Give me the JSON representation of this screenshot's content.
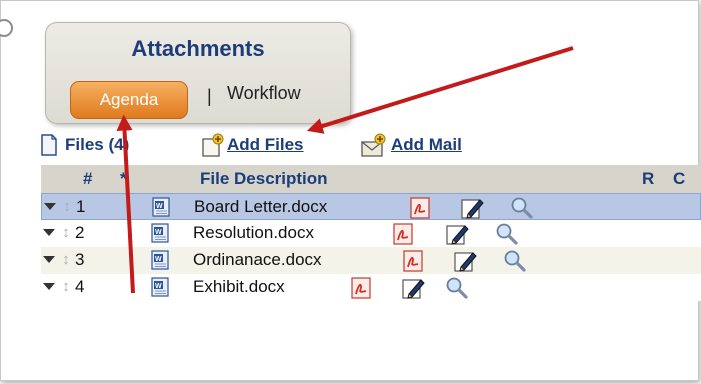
{
  "tabs": {
    "title": "Attachments",
    "agenda_label": "Agenda",
    "separator": "|",
    "workflow_label": "Workflow"
  },
  "toolbar": {
    "files_label": "Files (4)",
    "add_files_label": "Add Files",
    "add_mail_label": "Add Mail"
  },
  "table": {
    "headers": {
      "num": "#",
      "star": "*",
      "desc": "File Description",
      "r": "R",
      "c": "C"
    },
    "rows": [
      {
        "num": "1",
        "name": "Board Letter.docx"
      },
      {
        "num": "2",
        "name": "Resolution.docx"
      },
      {
        "num": "3",
        "name": "Ordinanace.docx"
      },
      {
        "num": "4",
        "name": "Exhibit.docx"
      }
    ]
  },
  "colors": {
    "accent_orange": "#e07a1e",
    "title_blue": "#1d3d7a",
    "arrow_red": "#c41a1a",
    "selected_row": "#b8c8e4"
  }
}
